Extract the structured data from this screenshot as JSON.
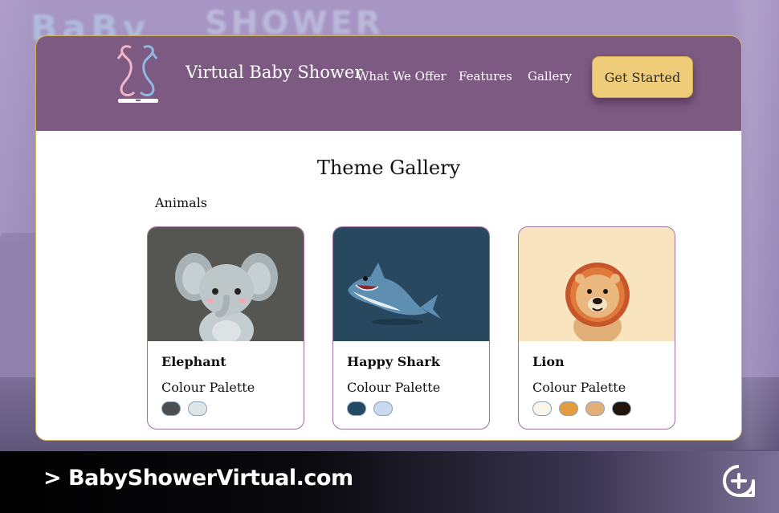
{
  "backdrop": {
    "text_left": "BaBy",
    "text_right": "SHOWER"
  },
  "header": {
    "brand": "Virtual Baby Shower",
    "nav": [
      "What We Offer",
      "Features",
      "Gallery"
    ],
    "cta": "Get Started",
    "color": "#7d5a82",
    "cta_color": "#efcc7a"
  },
  "main": {
    "title": "Theme Gallery",
    "section": "Animals",
    "themes": [
      {
        "name": "Elephant",
        "palette_label": "Colour Palette",
        "colors": [
          "#4b4f52",
          "#dfe6e8"
        ],
        "bg": "#555551",
        "icon": "elephant-illustration"
      },
      {
        "name": "Happy Shark",
        "palette_label": "Colour Palette",
        "colors": [
          "#244a63",
          "#c9d9ef"
        ],
        "bg": "#28485f",
        "icon": "shark-illustration"
      },
      {
        "name": "Lion",
        "palette_label": "Colour Palette",
        "colors": [
          "#fbf6ea",
          "#e39c3e",
          "#e0b078",
          "#22150e"
        ],
        "bg": "#f9e4c0",
        "icon": "lion-illustration"
      }
    ]
  },
  "footer": {
    "url": "> BabyShowerVirtual.com",
    "badge_icon": "zoom-plus-icon"
  }
}
